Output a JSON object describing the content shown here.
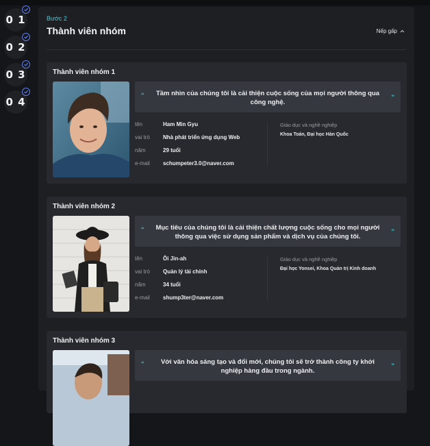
{
  "steps": [
    "0 1",
    "0 2",
    "0 3",
    "0 4"
  ],
  "header": {
    "step_label": "Bước 2",
    "title": "Thành viên nhóm",
    "collapse_label": "Nếp gấp"
  },
  "field_labels": {
    "name": "tên",
    "role": "vai trò",
    "age": "năm",
    "email": "e-mail",
    "education": "Giáo dục và nghề nghiệp"
  },
  "members": [
    {
      "title": "Thành viên nhóm 1",
      "quote": "Tầm nhìn của chúng tôi là cải thiện cuộc sống của mọi người thông qua công nghệ.",
      "name": "Ham Min Gyu",
      "role": "Nhà phát triển ứng dụng Web",
      "age": "29 tuổi",
      "email": "schumpeter3.0@naver.com",
      "education": "Khoa Toán, Đại học Hàn Quốc"
    },
    {
      "title": "Thành viên nhóm 2",
      "quote": "Mục tiêu của chúng tôi là cải thiện chất lượng cuộc sống cho mọi người thông qua việc sử dụng sản phẩm và dịch vụ của chúng tôi.",
      "name": "Ôi Jin-ah",
      "role": "Quản lý tài chính",
      "age": "34 tuổi",
      "email": "shump3ter@naver.com",
      "education": "Đại học Yonsei, Khoa Quản trị Kinh doanh"
    },
    {
      "title": "Thành viên nhóm 3",
      "quote": "Với văn hóa sáng tạo và đổi mới, chúng tôi sẽ trở thành công ty khởi nghiệp hàng đầu trong ngành."
    }
  ],
  "colors": {
    "accent": "#4fc9d4",
    "check": "#5f7ff0",
    "panel": "#1d1f23",
    "card": "#27292e"
  }
}
